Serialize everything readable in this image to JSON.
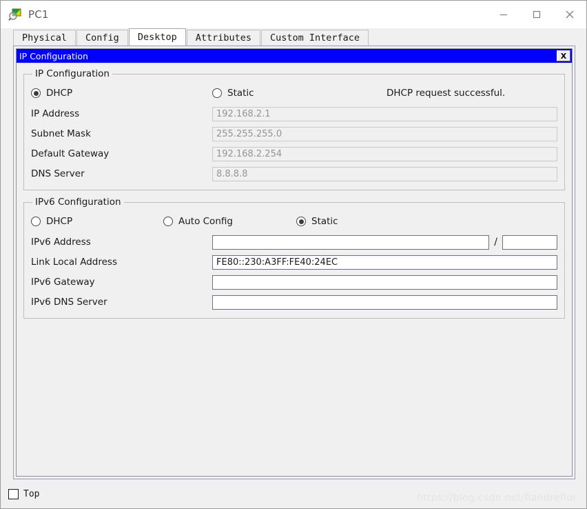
{
  "window": {
    "title": "PC1",
    "icon": "pc-magnifier-icon",
    "minimize_label": "—",
    "maximize_label": "□",
    "close_label": "✕"
  },
  "tabs": [
    {
      "label": "Physical",
      "active": false
    },
    {
      "label": "Config",
      "active": false
    },
    {
      "label": "Desktop",
      "active": true
    },
    {
      "label": "Attributes",
      "active": false
    },
    {
      "label": "Custom Interface",
      "active": false
    }
  ],
  "ip_config_window": {
    "title": "IP Configuration",
    "close_label": "X"
  },
  "ipv4": {
    "legend": "IP Configuration",
    "mode": "DHCP",
    "options": [
      {
        "label": "DHCP",
        "checked": true
      },
      {
        "label": "Static",
        "checked": false
      }
    ],
    "status": "DHCP request successful.",
    "fields": [
      {
        "label": "IP Address",
        "value": "192.168.2.1",
        "disabled": true
      },
      {
        "label": "Subnet Mask",
        "value": "255.255.255.0",
        "disabled": true
      },
      {
        "label": "Default Gateway",
        "value": "192.168.2.254",
        "disabled": true
      },
      {
        "label": "DNS Server",
        "value": "8.8.8.8",
        "disabled": true
      }
    ]
  },
  "ipv6": {
    "legend": "IPv6 Configuration",
    "mode": "Static",
    "options": [
      {
        "label": "DHCP",
        "checked": false
      },
      {
        "label": "Auto Config",
        "checked": false
      },
      {
        "label": "Static",
        "checked": true
      }
    ],
    "address": {
      "label": "IPv6 Address",
      "value": "",
      "prefix": "",
      "separator": "/"
    },
    "fields": [
      {
        "label": "Link Local Address",
        "value": "FE80::230:A3FF:FE40:24EC",
        "disabled": false
      },
      {
        "label": "IPv6 Gateway",
        "value": "",
        "disabled": false
      },
      {
        "label": "IPv6 DNS Server",
        "value": "",
        "disabled": false
      }
    ]
  },
  "bottom": {
    "top_checkbox_label": "Top",
    "top_checked": false,
    "watermark": "https://blog.csdn.net/fiandreflor"
  },
  "colors": {
    "titlebar_blue": "#0000ff",
    "window_bg": "#f0f0f0",
    "text": "#1a1a1a",
    "disabled_text": "#949494"
  }
}
